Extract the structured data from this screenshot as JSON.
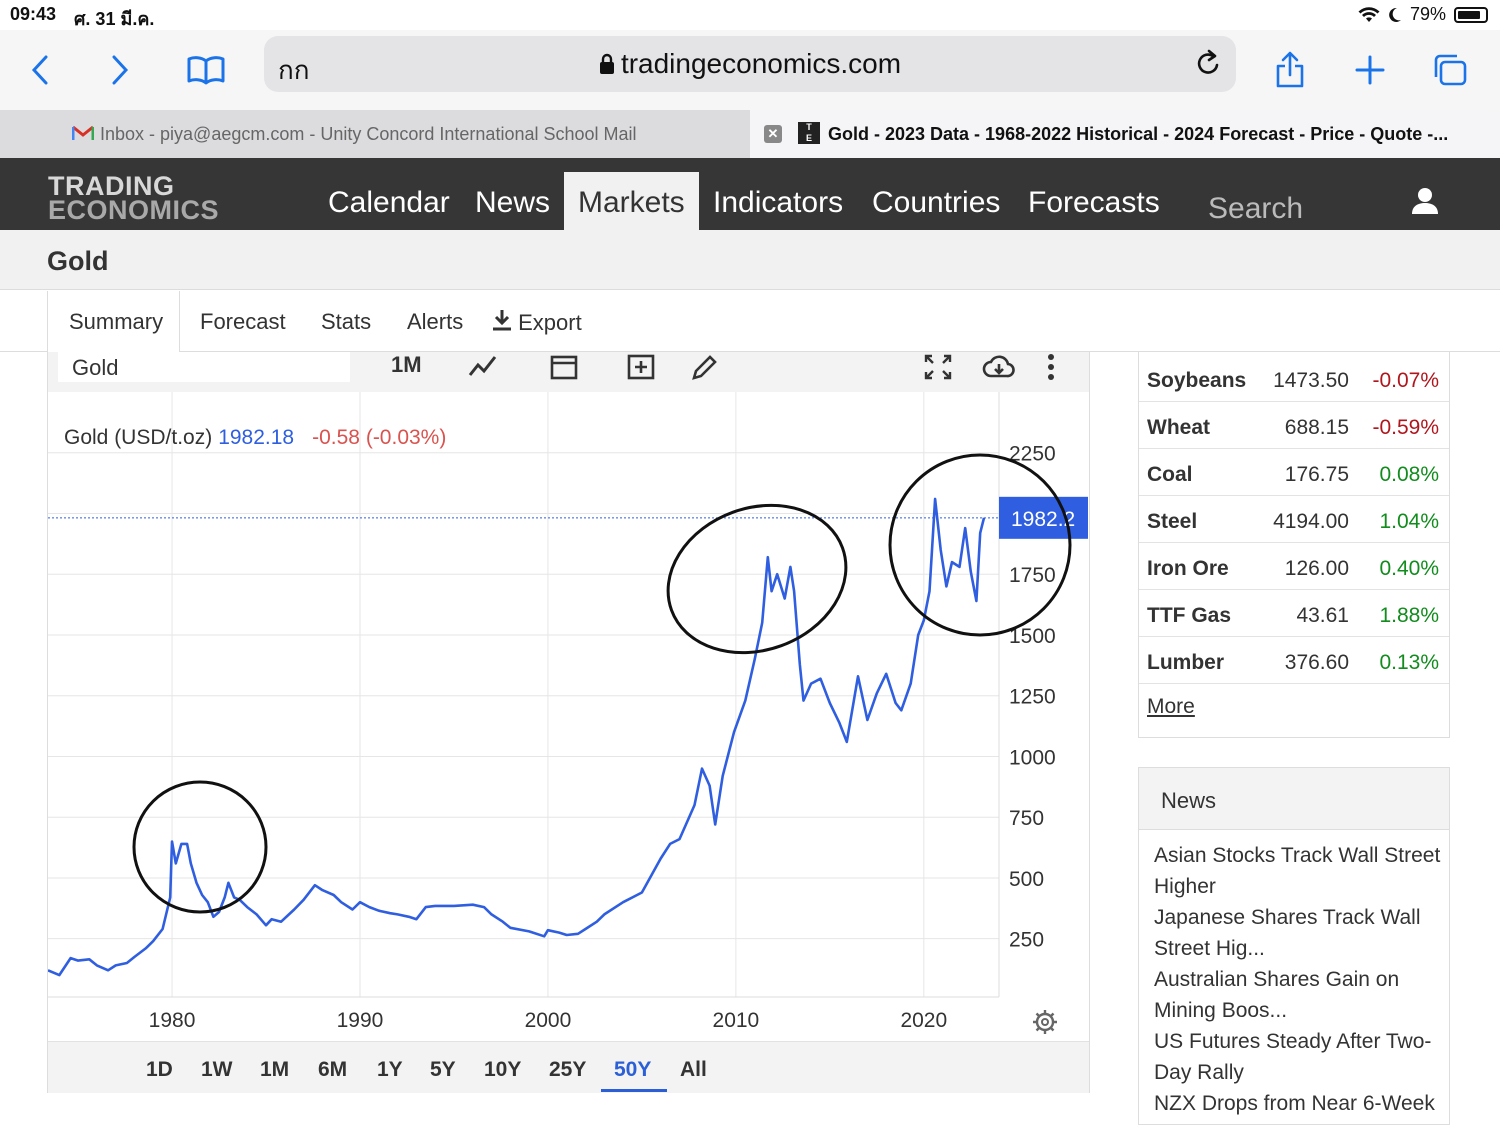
{
  "status": {
    "time": "09:43",
    "date": "ศ. 31 มี.ค.",
    "battery": "79%"
  },
  "browser": {
    "aa_label": "กก",
    "url": "tradingeconomics.com",
    "tabs": [
      {
        "title": "Inbox - piya@aegcm.com - Unity Concord International School Mail"
      },
      {
        "title": "Gold - 2023 Data - 1968-2022 Historical - 2024 Forecast - Price - Quote -..."
      }
    ]
  },
  "site": {
    "logo_line1": "TRADING",
    "logo_line2": "ECONOMICS",
    "nav": [
      "Calendar",
      "News",
      "Markets",
      "Indicators",
      "Countries",
      "Forecasts"
    ],
    "search_placeholder": "Search"
  },
  "page": {
    "title": "Gold"
  },
  "subtabs": [
    "Summary",
    "Forecast",
    "Stats",
    "Alerts",
    "Export"
  ],
  "chart_toolbar": {
    "symbol": "Gold",
    "interval": "1M"
  },
  "quote": {
    "label": "Gold (USD/t.oz)",
    "price": "1982.18",
    "change": "-0.58 (-0.03%)",
    "last_tag": "1982.2"
  },
  "ranges": [
    "1D",
    "1W",
    "1M",
    "6M",
    "1Y",
    "5Y",
    "10Y",
    "25Y",
    "50Y",
    "All"
  ],
  "active_range": "50Y",
  "chart_data": {
    "type": "line",
    "title": "",
    "xlabel": "",
    "ylabel": "",
    "x_ticks": [
      "1980",
      "1990",
      "2000",
      "2010",
      "2020"
    ],
    "y_ticks": [
      "250",
      "500",
      "750",
      "1000",
      "1250",
      "1500",
      "1750",
      "2250"
    ],
    "xlim": [
      1973.4,
      2024.0
    ],
    "ylim": [
      10,
      2500
    ],
    "grid": true,
    "axis_side": "right",
    "series": [
      {
        "color": "#2f5fe0",
        "points": [
          [
            1973.4,
            120
          ],
          [
            1974.0,
            100
          ],
          [
            1974.6,
            170
          ],
          [
            1975.0,
            160
          ],
          [
            1975.6,
            165
          ],
          [
            1976.0,
            140
          ],
          [
            1976.6,
            120
          ],
          [
            1977.0,
            140
          ],
          [
            1977.6,
            150
          ],
          [
            1978.0,
            175
          ],
          [
            1978.6,
            210
          ],
          [
            1979.0,
            240
          ],
          [
            1979.5,
            290
          ],
          [
            1979.9,
            420
          ],
          [
            1980.0,
            650
          ],
          [
            1980.2,
            560
          ],
          [
            1980.5,
            640
          ],
          [
            1980.8,
            640
          ],
          [
            1981.0,
            560
          ],
          [
            1981.3,
            480
          ],
          [
            1981.6,
            430
          ],
          [
            1981.9,
            400
          ],
          [
            1982.2,
            340
          ],
          [
            1982.5,
            360
          ],
          [
            1982.8,
            420
          ],
          [
            1983.0,
            480
          ],
          [
            1983.3,
            420
          ],
          [
            1983.6,
            410
          ],
          [
            1984.0,
            380
          ],
          [
            1984.5,
            350
          ],
          [
            1985.0,
            305
          ],
          [
            1985.3,
            330
          ],
          [
            1985.8,
            320
          ],
          [
            1986.5,
            370
          ],
          [
            1987.0,
            410
          ],
          [
            1987.6,
            470
          ],
          [
            1988.0,
            450
          ],
          [
            1988.6,
            430
          ],
          [
            1989.0,
            400
          ],
          [
            1989.6,
            370
          ],
          [
            1990.0,
            400
          ],
          [
            1990.5,
            380
          ],
          [
            1991.0,
            365
          ],
          [
            1991.6,
            355
          ],
          [
            1992.0,
            350
          ],
          [
            1992.6,
            340
          ],
          [
            1993.0,
            330
          ],
          [
            1993.5,
            380
          ],
          [
            1994.0,
            385
          ],
          [
            1995.0,
            385
          ],
          [
            1996.0,
            390
          ],
          [
            1996.6,
            380
          ],
          [
            1997.0,
            350
          ],
          [
            1997.6,
            320
          ],
          [
            1998.0,
            295
          ],
          [
            1999.0,
            280
          ],
          [
            1999.8,
            260
          ],
          [
            2000.0,
            285
          ],
          [
            2000.6,
            275
          ],
          [
            2001.0,
            265
          ],
          [
            2001.6,
            270
          ],
          [
            2002.0,
            290
          ],
          [
            2002.6,
            320
          ],
          [
            2003.0,
            350
          ],
          [
            2004.0,
            400
          ],
          [
            2005.0,
            440
          ],
          [
            2006.0,
            580
          ],
          [
            2006.5,
            640
          ],
          [
            2007.0,
            660
          ],
          [
            2007.8,
            800
          ],
          [
            2008.2,
            950
          ],
          [
            2008.6,
            880
          ],
          [
            2008.9,
            720
          ],
          [
            2009.3,
            920
          ],
          [
            2009.9,
            1100
          ],
          [
            2010.5,
            1230
          ],
          [
            2011.0,
            1400
          ],
          [
            2011.4,
            1550
          ],
          [
            2011.7,
            1820
          ],
          [
            2011.9,
            1680
          ],
          [
            2012.2,
            1750
          ],
          [
            2012.6,
            1650
          ],
          [
            2012.9,
            1780
          ],
          [
            2013.1,
            1680
          ],
          [
            2013.4,
            1380
          ],
          [
            2013.6,
            1230
          ],
          [
            2014.0,
            1300
          ],
          [
            2014.5,
            1320
          ],
          [
            2015.0,
            1220
          ],
          [
            2015.5,
            1140
          ],
          [
            2015.9,
            1060
          ],
          [
            2016.5,
            1330
          ],
          [
            2017.0,
            1150
          ],
          [
            2017.5,
            1260
          ],
          [
            2018.0,
            1340
          ],
          [
            2018.5,
            1220
          ],
          [
            2018.8,
            1190
          ],
          [
            2019.3,
            1300
          ],
          [
            2019.7,
            1500
          ],
          [
            2020.0,
            1560
          ],
          [
            2020.3,
            1680
          ],
          [
            2020.6,
            2060
          ],
          [
            2020.9,
            1850
          ],
          [
            2021.2,
            1700
          ],
          [
            2021.5,
            1800
          ],
          [
            2021.9,
            1780
          ],
          [
            2022.2,
            1940
          ],
          [
            2022.5,
            1760
          ],
          [
            2022.8,
            1640
          ],
          [
            2023.0,
            1920
          ],
          [
            2023.2,
            1982.18
          ]
        ]
      }
    ],
    "last_value": 1982.18
  },
  "markets_table": [
    {
      "name": "Soybeans",
      "value": "1473.50",
      "change": "-0.07%",
      "dir": "neg"
    },
    {
      "name": "Wheat",
      "value": "688.15",
      "change": "-0.59%",
      "dir": "neg"
    },
    {
      "name": "Coal",
      "value": "176.75",
      "change": "0.08%",
      "dir": "pos"
    },
    {
      "name": "Steel",
      "value": "4194.00",
      "change": "1.04%",
      "dir": "pos"
    },
    {
      "name": "Iron Ore",
      "value": "126.00",
      "change": "0.40%",
      "dir": "pos"
    },
    {
      "name": "TTF Gas",
      "value": "43.61",
      "change": "1.88%",
      "dir": "pos"
    },
    {
      "name": "Lumber",
      "value": "376.60",
      "change": "0.13%",
      "dir": "pos"
    }
  ],
  "more_label": "More",
  "news": {
    "heading": "News",
    "items": [
      "Asian Stocks Track Wall Street Higher",
      "Japanese Shares Track Wall Street Hig...",
      "Australian Shares Gain on Mining Boos...",
      "US Futures Steady After Two-Day Rally",
      "NZX Drops from Near 6-Week High"
    ]
  }
}
